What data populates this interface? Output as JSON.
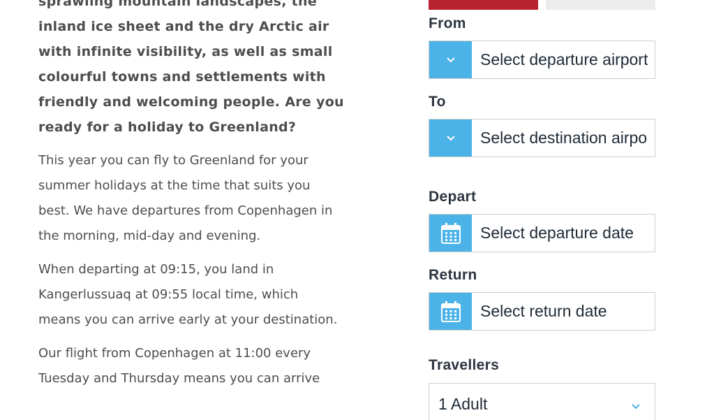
{
  "article": {
    "intro_lines": [
      "sprawling mountain landscapes, the",
      "inland ice sheet and the dry Arctic air",
      "with infinite visibility, as well as small",
      "colourful towns and settlements with",
      "friendly and welcoming people. Are you",
      "ready for a holiday to Greenland?"
    ],
    "paragraph_1_lines": [
      "This year you can fly to Greenland for your",
      "summer holidays at the time that suits you",
      "best. We have departures from Copenhagen in",
      "the morning, mid-day and evening."
    ],
    "paragraph_2_lines": [
      "When departing at 09:15, you land in",
      "Kangerlussuaq at 09:55 local time, which",
      "means you can arrive early at your destination."
    ],
    "paragraph_3_lines": [
      "Our flight from Copenhagen at 11:00 every",
      "Tuesday and Thursday means you can arrive"
    ]
  },
  "booking_form": {
    "from": {
      "label": "From",
      "placeholder": "Select departure airport",
      "icon": "chevron-down-icon"
    },
    "to": {
      "label": "To",
      "placeholder": "Select destination airport",
      "icon": "chevron-down-icon"
    },
    "depart": {
      "label": "Depart",
      "placeholder": "Select departure date",
      "icon": "calendar-icon"
    },
    "return": {
      "label": "Return",
      "placeholder": "Select return date",
      "icon": "calendar-icon"
    },
    "travellers": {
      "label": "Travellers",
      "value": "1 Adult",
      "icon": "chevron-down-icon"
    },
    "colors": {
      "accent_blue": "#4cb3e8",
      "active_tab_red": "#b8232f",
      "inactive_tab_grey": "#ececec"
    }
  }
}
